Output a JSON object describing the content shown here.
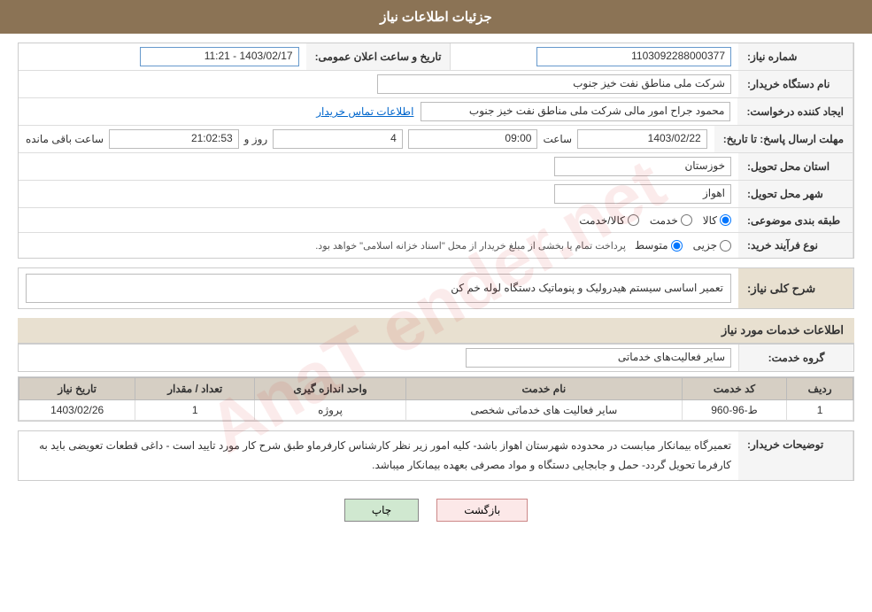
{
  "header": {
    "title": "جزئیات اطلاعات نیاز"
  },
  "fields": {
    "need_number_label": "شماره نیاز:",
    "need_number_value": "1103092288000377",
    "buyer_name_label": "نام دستگاه خریدار:",
    "buyer_name_value": "شرکت ملی مناطق نفت خیز جنوب",
    "requester_label": "ایجاد کننده درخواست:",
    "requester_value": "محمود جراح امور مالی شرکت ملی مناطق نفت خیز جنوب",
    "contact_link": "اطلاعات تماس خریدار",
    "deadline_label": "مهلت ارسال پاسخ: تا تاریخ:",
    "deadline_date": "1403/02/22",
    "deadline_time_label": "ساعت",
    "deadline_time": "09:00",
    "deadline_day_label": "روز و",
    "deadline_days": "4",
    "deadline_remaining_label": "ساعت باقی مانده",
    "deadline_remaining": "21:02:53",
    "province_label": "استان محل تحویل:",
    "province_value": "خوزستان",
    "city_label": "شهر محل تحویل:",
    "city_value": "اهواز",
    "category_label": "طبقه بندی موضوعی:",
    "category_options": [
      "کالا",
      "خدمت",
      "کالا/خدمت"
    ],
    "category_selected": "کالا",
    "purchase_type_label": "نوع فرآیند خرید:",
    "purchase_type_options": [
      "جزیی",
      "متوسط"
    ],
    "purchase_note": "پرداخت تمام یا بخشی از مبلغ خریدار از محل \"اسناد خزانه اسلامی\" خواهد بود.",
    "announce_label": "تاریخ و ساعت اعلان عمومی:",
    "announce_value": "1403/02/17 - 11:21",
    "need_description_label": "شرح کلی نیاز:",
    "need_description_value": "تعمیر اساسی سیستم هیدرولیک و پنوماتیک دستگاه لوله خم کن"
  },
  "service_section": {
    "title": "اطلاعات خدمات مورد نیاز",
    "group_label": "گروه خدمت:",
    "group_value": "سایر فعالیت‌های خدماتی",
    "table": {
      "headers": [
        "ردیف",
        "کد خدمت",
        "نام خدمت",
        "واحد اندازه گیری",
        "تعداد / مقدار",
        "تاریخ نیاز"
      ],
      "rows": [
        {
          "row": "1",
          "code": "ط-96-960",
          "name": "سایر فعالیت های خدماتی شخصی",
          "unit": "پروژه",
          "count": "1",
          "date": "1403/02/26"
        }
      ]
    }
  },
  "buyer_description": {
    "label": "توضیحات خریدار:",
    "text": "تعمیرگاه بیمانکار میابست در محدوده شهرستان اهواز باشد- کلیه امور زیر نظر کارشناس کارفرماو طبق شرح کار مورد تایید است - داغی قطعات تعویضی باید به کارفرما تحویل گردد- حمل و جابجایی دستگاه و مواد مصرفی بعهده بیمانکار میباشد."
  },
  "buttons": {
    "print": "چاپ",
    "back": "بازگشت"
  }
}
